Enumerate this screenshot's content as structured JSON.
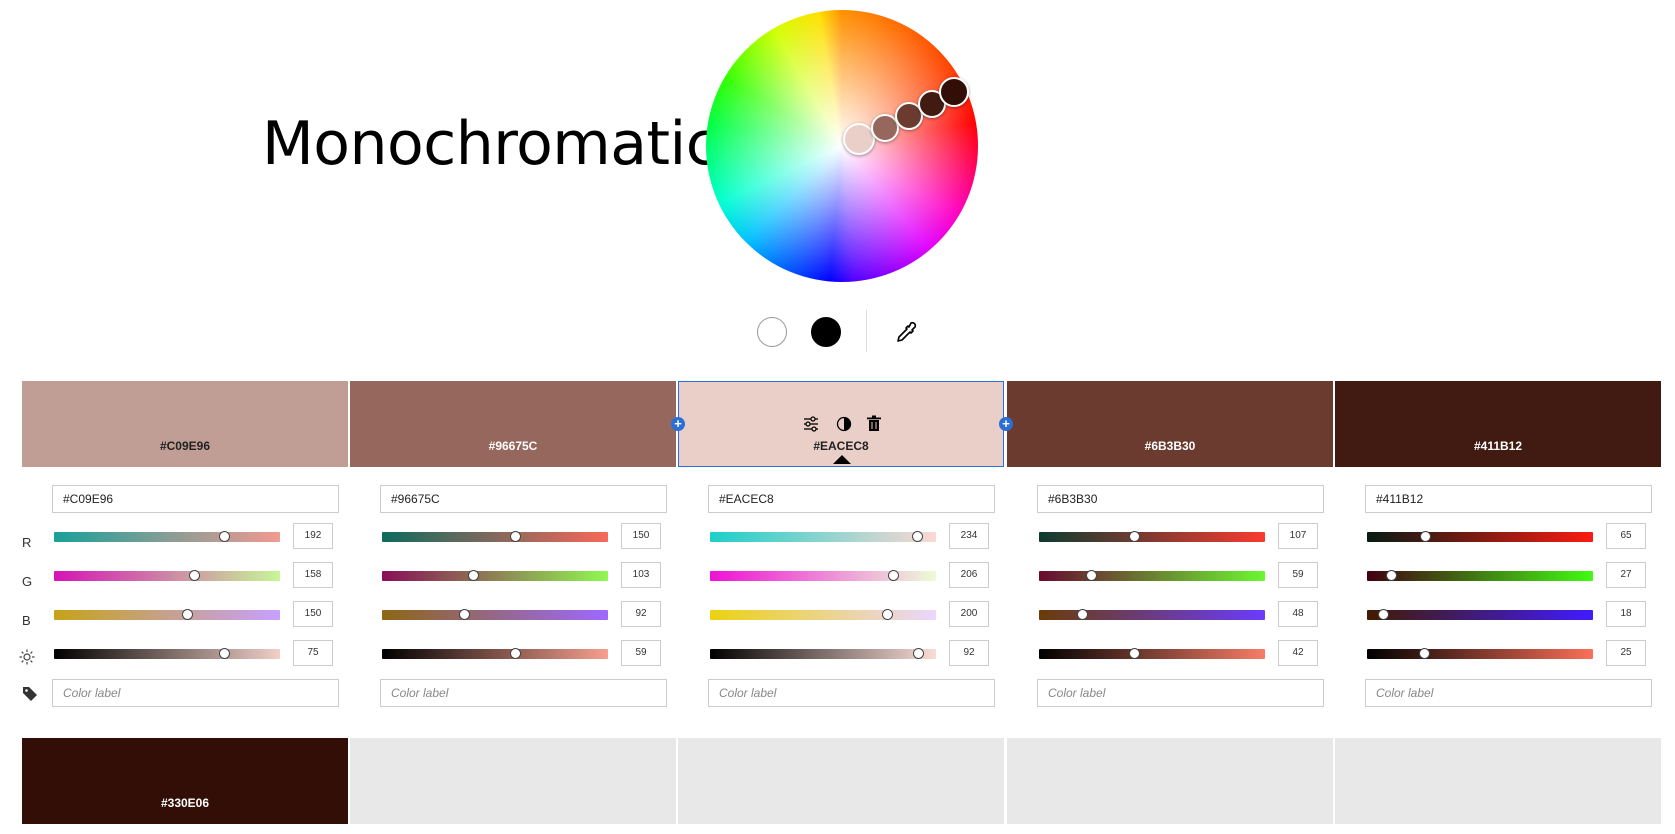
{
  "title": "Monochromatic",
  "wheel_handles": [
    {
      "color": "#EACEC8",
      "size": 32
    },
    {
      "color": "#96675C",
      "size": 28
    },
    {
      "color": "#6B3B30",
      "size": 28
    },
    {
      "color": "#411B12",
      "size": 28
    },
    {
      "color": "#330E06",
      "size": 30
    }
  ],
  "swatches": [
    {
      "hex": "#C09E96",
      "text_color": "#222",
      "r": 192,
      "g": 158,
      "b": 150,
      "brightness": 75,
      "r_grad": [
        "#19a09a",
        "#f29a90"
      ],
      "g_grad": [
        "#d613b6",
        "#c7f796"
      ],
      "b_grad": [
        "#c6a218",
        "#c7a0ff"
      ],
      "l_grad": [
        "#000000",
        "#f0cfc7"
      ]
    },
    {
      "hex": "#96675C",
      "text_color": "#fff",
      "r": 150,
      "g": 103,
      "b": 92,
      "brightness": 59,
      "r_grad": [
        "#0e6a5d",
        "#f8685a"
      ],
      "g_grad": [
        "#8a0e58",
        "#90f850"
      ],
      "b_grad": [
        "#8e6614",
        "#9e68ff"
      ],
      "l_grad": [
        "#000000",
        "#f6a08f"
      ]
    },
    {
      "hex": "#EACEC8",
      "text_color": "#222",
      "r": 234,
      "g": 206,
      "b": 200,
      "brightness": 92,
      "r_grad": [
        "#1ccfca",
        "#fdd8d2"
      ],
      "g_grad": [
        "#ef11d6",
        "#edfcd8"
      ],
      "b_grad": [
        "#ecd112",
        "#ebd6ff"
      ],
      "l_grad": [
        "#000000",
        "#fadcd6"
      ]
    },
    {
      "hex": "#6B3B30",
      "text_color": "#fff",
      "r": 107,
      "g": 59,
      "b": 48,
      "brightness": 42,
      "r_grad": [
        "#0c3b30",
        "#fa3a30"
      ],
      "g_grad": [
        "#6a0a30",
        "#6af830"
      ],
      "b_grad": [
        "#6b3b08",
        "#6b3bff"
      ],
      "l_grad": [
        "#000000",
        "#f77d67"
      ]
    },
    {
      "hex": "#411B12",
      "text_color": "#fff",
      "r": 65,
      "g": 27,
      "b": 18,
      "brightness": 25,
      "r_grad": [
        "#061b12",
        "#fb1b12"
      ],
      "g_grad": [
        "#410012",
        "#41fb12"
      ],
      "b_grad": [
        "#411b00",
        "#411bff"
      ],
      "l_grad": [
        "#000000",
        "#fb7058"
      ]
    }
  ],
  "row_labels": {
    "r": "R",
    "g": "G",
    "b": "B"
  },
  "color_label_placeholder": "Color label",
  "bottom_swatch": {
    "hex": "#330E06",
    "color": "#330E06"
  },
  "icons": {
    "adjust": "sliders-icon",
    "contrast": "contrast-icon",
    "delete": "trash-icon",
    "add": "plus-icon",
    "eyedropper": "eyedropper-icon",
    "brightness": "sun-icon",
    "tag": "tag-icon"
  }
}
